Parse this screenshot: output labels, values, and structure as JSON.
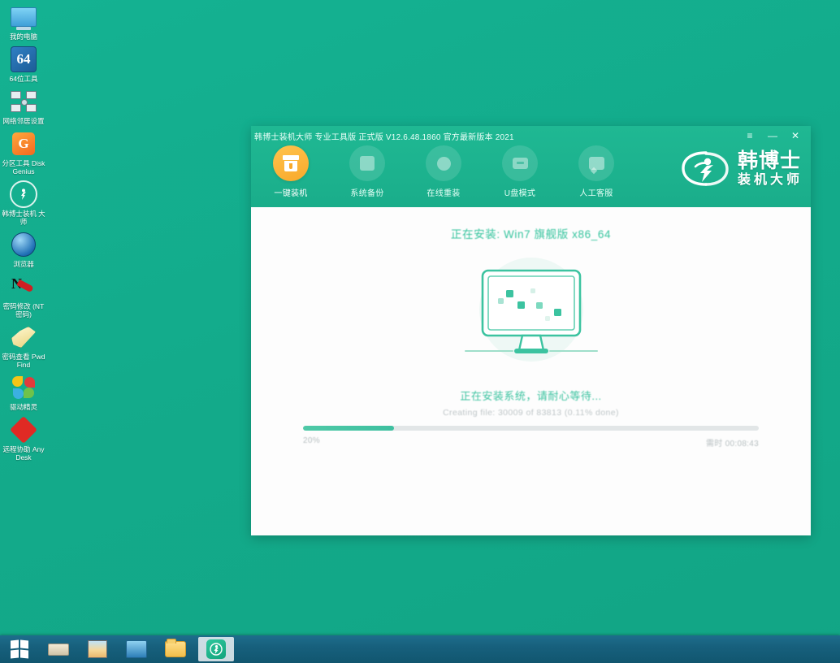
{
  "desktop": {
    "icons": [
      {
        "label": "我的电脑",
        "icon": "computer-icon"
      },
      {
        "label": "64位工具",
        "icon": "sixtyfour-icon"
      },
      {
        "label": "网络邻居设置",
        "icon": "network-icon"
      },
      {
        "label": "分区工具\nDiskGenius",
        "icon": "diskgenius-icon"
      },
      {
        "label": "韩博士装机\n大师",
        "icon": "hanboshi-icon"
      },
      {
        "label": "浏览器",
        "icon": "browser-icon"
      },
      {
        "label": "密码修改\n(NT密码)",
        "icon": "nt-password-icon"
      },
      {
        "label": "密码查看\nPwdFind",
        "icon": "pwdfind-icon"
      },
      {
        "label": "驱动精灵",
        "icon": "driver-genius-icon"
      },
      {
        "label": "远程协助\nAnyDesk",
        "icon": "anydesk-icon"
      }
    ]
  },
  "taskbar": {
    "items": [
      {
        "name": "start-button",
        "icon": "windows-logo-icon"
      },
      {
        "name": "taskbar-drive",
        "icon": "drive-icon"
      },
      {
        "name": "taskbar-picture-viewer",
        "icon": "picture-icon"
      },
      {
        "name": "taskbar-my-computer",
        "icon": "computer-icon"
      },
      {
        "name": "taskbar-explorer",
        "icon": "folder-icon"
      },
      {
        "name": "taskbar-hanboshi",
        "icon": "hanboshi-icon"
      }
    ]
  },
  "window": {
    "title": "韩博士装机大师 专业工具版 正式版 V12.6.48.1860 官方最新版本 2021",
    "controls": {
      "menu": "≡",
      "minimize": "—",
      "close": "✕"
    },
    "nav": [
      {
        "label": "一键装机",
        "icon": "install-box-icon",
        "active": true
      },
      {
        "label": "系统备份",
        "icon": "backup-icon",
        "active": false
      },
      {
        "label": "在线重装",
        "icon": "online-reinstall-icon",
        "active": false
      },
      {
        "label": "U盘模式",
        "icon": "usb-icon",
        "active": false
      },
      {
        "label": "人工客服",
        "icon": "support-chat-icon",
        "active": false
      }
    ],
    "brand": {
      "main": "韩博士",
      "sub": "装机大师",
      "mark": "running-person-circle-icon"
    },
    "content": {
      "install_title": "正在安装: Win7 旗舰版 x86_64",
      "status_cn": "正在安装系统，请耐心等待...",
      "status_en": "Creating file: 30009 of 83813 (0.11% done)",
      "progress_percent_label": "20%",
      "progress_value": 20,
      "time_remaining_label": "需时 00:08:43",
      "illustration": "monitor-illustration"
    }
  },
  "colors": {
    "brand_green": "#1ab28d",
    "desktop_green": "#13ab8b",
    "accent_orange": "#f9a92b",
    "progress_teal": "#4fc9a7",
    "taskbar_blue": "#17607d"
  }
}
